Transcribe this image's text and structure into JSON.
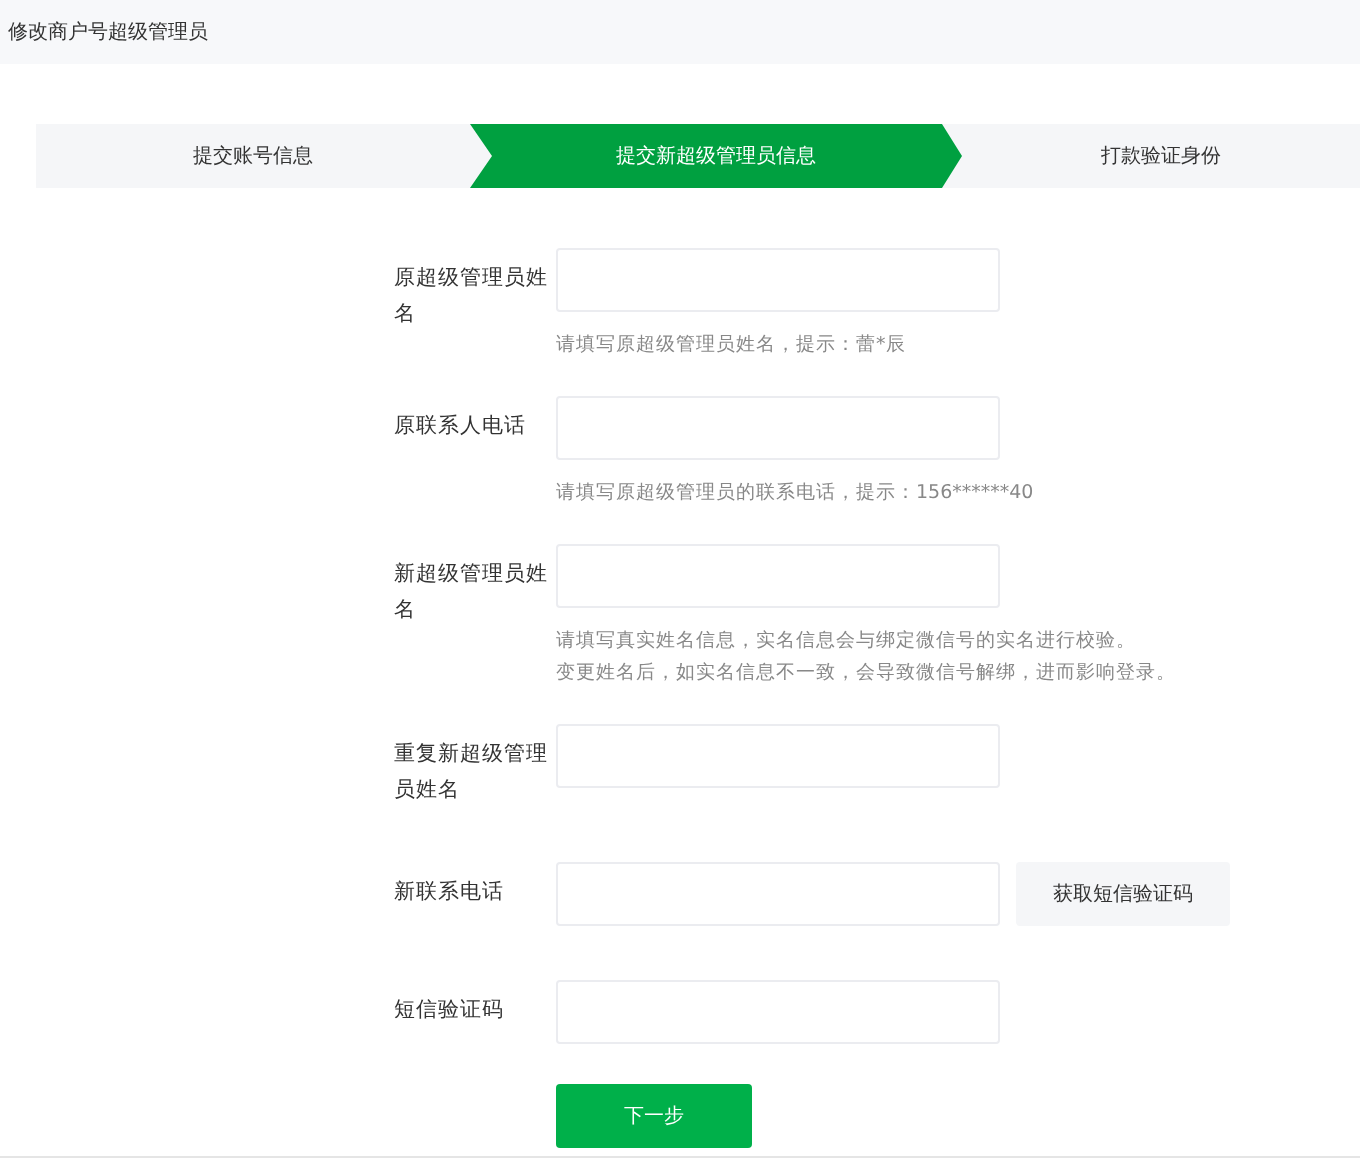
{
  "page_title": "修改商户号超级管理员",
  "steps": [
    {
      "label": "提交账号信息",
      "selected": false
    },
    {
      "label": "提交新超级管理员信息",
      "selected": true
    },
    {
      "label": "打款验证身份",
      "selected": false
    }
  ],
  "fields": [
    {
      "label": "原超级管理员姓名",
      "hints": [
        "请填写原超级管理员姓名，提示：蕾*辰"
      ]
    },
    {
      "label": "原联系人电话",
      "hints": [
        "请填写原超级管理员的联系电话，提示：156******40"
      ]
    },
    {
      "label": "新超级管理员姓名",
      "hints": [
        "请填写真实姓名信息，实名信息会与绑定微信号的实名进行校验。",
        "变更姓名后，如实名信息不一致，会导致微信号解绑，进而影响登录。"
      ]
    },
    {
      "label": "重复新超级管理员姓名"
    },
    {
      "label": "新联系电话",
      "action": "获取短信验证码"
    },
    {
      "label": "短信验证码"
    }
  ],
  "submit": "下一步"
}
